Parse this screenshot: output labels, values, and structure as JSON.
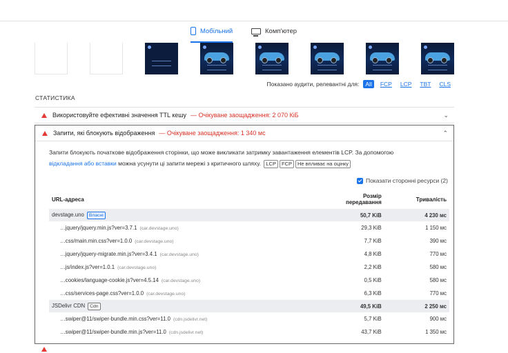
{
  "tabs": {
    "mobile": "Мобільний",
    "desktop": "Комп'ютер"
  },
  "filter": {
    "label": "Показано аудити, релевантні для:",
    "options": [
      "All",
      "FCP",
      "LCP",
      "TBT",
      "CLS"
    ]
  },
  "section_title": "СТАТИСТИКА",
  "audit1": {
    "title": "Використовуйте ефективні значення TTL кешу",
    "savings": "— Очікуване заощадження: 2 070 КіБ"
  },
  "audit2": {
    "title": "Запити, які блокують відображення",
    "savings": "— Очікуване заощадження: 1 340 мс",
    "desc_part1": "Запити блокують початкове відображення сторінки, що може викликати затримку завантаження елементів LCP. За допомогою",
    "desc_link": "відкладання або вставки",
    "desc_part2": "можна усунути ці запити мережі з критичного шляху.",
    "tags": [
      "LCP",
      "FCP",
      "Не впливає на оцінку"
    ],
    "third_party_label": "Показати сторонні ресурси (2)",
    "columns": {
      "url": "URL-адреса",
      "size_line1": "Розмір",
      "size_line2": "передавання",
      "duration": "Тривалість"
    },
    "groups": [
      {
        "name": "devstage.uno",
        "badge": "Власні",
        "size": "50,7 KiB",
        "duration": "4 230 мс",
        "rows": [
          {
            "url": "…jquery/jquery.min.js?ver=3.7.1",
            "host": "(car.devstage.uno)",
            "size": "29,3 KiB",
            "duration": "1 150 мс"
          },
          {
            "url": "…css/main.min.css?ver=1.0.0",
            "host": "(car.devstage.uno)",
            "size": "7,7 KiB",
            "duration": "390 мс"
          },
          {
            "url": "…jquery/jquery-migrate.min.js?ver=3.4.1",
            "host": "(car.devstage.uno)",
            "size": "4,8 KiB",
            "duration": "770 мс"
          },
          {
            "url": "…js/index.js?ver=1.0.1",
            "host": "(car.devstage.uno)",
            "size": "2,2 KiB",
            "duration": "580 мс"
          },
          {
            "url": "…cookies/language-cookie.js?ver=4.5.14",
            "host": "(car.devstage.uno)",
            "size": "0,5 KiB",
            "duration": "580 мс"
          },
          {
            "url": "…css/services-page.css?ver=1.0.0",
            "host": "(car.devstage.uno)",
            "size": "6,3 KiB",
            "duration": "770 мс"
          }
        ]
      },
      {
        "name": "JSDelivr CDN",
        "badge": "Cdn",
        "size": "49,5 KiB",
        "duration": "2 250 мс",
        "rows": [
          {
            "url": "…swiper@11/swiper-bundle.min.css?ver=11.0",
            "host": "(cdn.jsdelivr.net)",
            "size": "5,7 KiB",
            "duration": "900 мс"
          },
          {
            "url": "…swiper@11/swiper-bundle.min.js?ver=11.0",
            "host": "(cdn.jsdelivr.net)",
            "size": "43,7 KiB",
            "duration": "1 350 мс"
          }
        ]
      }
    ]
  },
  "icons": {
    "warning": "warning-triangle-icon",
    "chevron": "chevron-icon",
    "mobile": "phone-icon",
    "desktop": "monitor-icon"
  },
  "colors": {
    "accent": "#1a73e8",
    "error": "#d93025",
    "group_bg": "#ebedf0"
  }
}
